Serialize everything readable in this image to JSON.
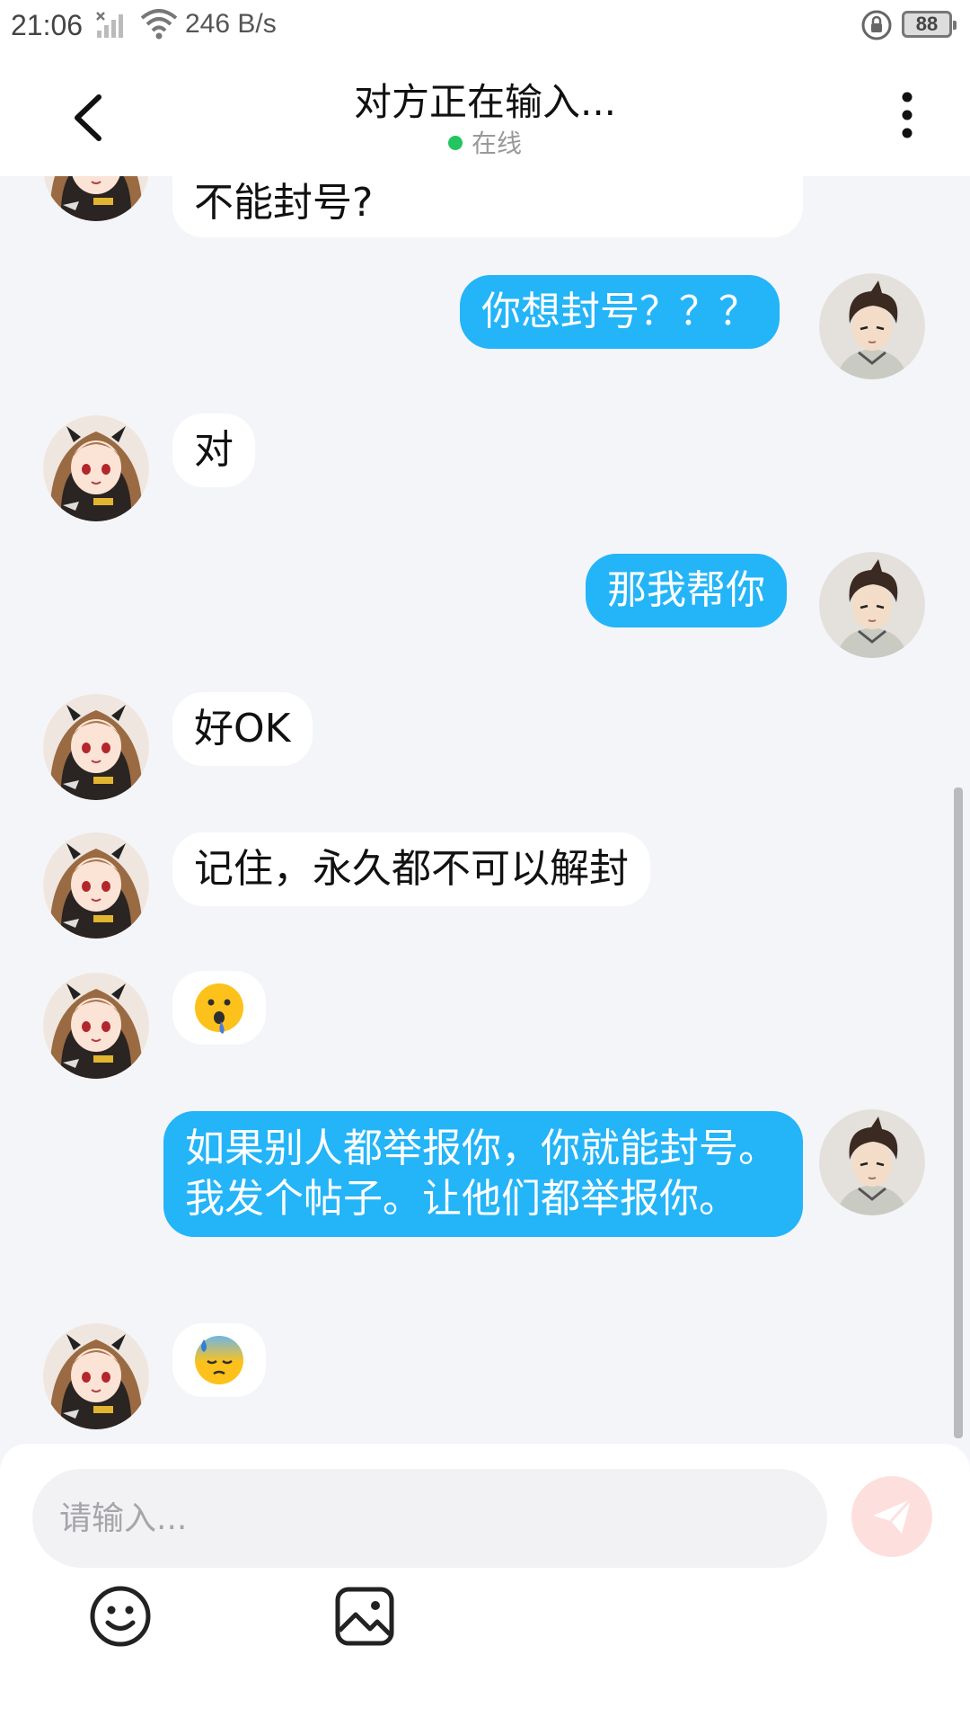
{
  "status_bar": {
    "time": "21:06",
    "speed": "246 B/s",
    "battery": "88"
  },
  "header": {
    "title": "对方正在输入...",
    "presence": "在线",
    "presence_color": "#22c55e"
  },
  "messages": [
    {
      "side": "in",
      "text": "不能封号?"
    },
    {
      "side": "out",
      "text": "你想封号？？？"
    },
    {
      "side": "in",
      "text": "对"
    },
    {
      "side": "out",
      "text": "那我帮你"
    },
    {
      "side": "in",
      "text": "好OK"
    },
    {
      "side": "in",
      "text": "记住，永久都不可以解封"
    },
    {
      "side": "in",
      "text": "😲",
      "kind": "emoji"
    },
    {
      "side": "out",
      "text": "如果别人都举报你，你就能封号。我发个帖子。让他们都举报你。"
    },
    {
      "side": "in",
      "text": "😓",
      "kind": "emoji"
    }
  ],
  "composer": {
    "placeholder": "请输入..."
  },
  "colors": {
    "outgoing_bubble": "#24b4f8",
    "incoming_bubble": "#ffffff",
    "background": "#f4f5f8",
    "send_button": "#fde0de"
  },
  "icons": [
    "back-arrow-icon",
    "more-vertical-icon",
    "send-icon",
    "emoji-icon",
    "image-icon",
    "wifi-icon",
    "signal-icon",
    "lock-rotation-icon",
    "battery-icon"
  ]
}
